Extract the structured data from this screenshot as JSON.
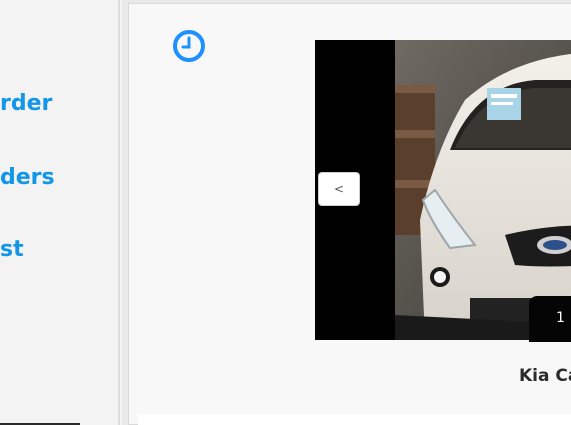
{
  "sidebar": {
    "items": [
      {
        "label": "rder"
      },
      {
        "label": "ders"
      },
      {
        "label": "st"
      }
    ]
  },
  "main": {
    "history_icon": "clock-icon",
    "carousel": {
      "prev_label": "<",
      "counter": "1",
      "image": "white-car-photo"
    },
    "listing_title": "Kia Ca"
  },
  "colors": {
    "accent": "#1296e8",
    "clock": "#1e90ff",
    "title": "#2b2b2b"
  }
}
